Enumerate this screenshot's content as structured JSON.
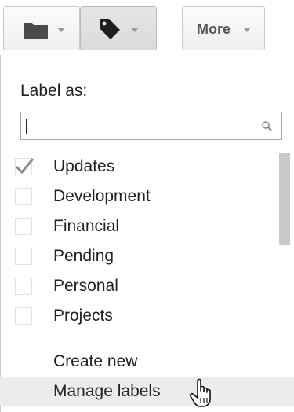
{
  "toolbar": {
    "folder_icon": "folder-icon",
    "label_icon": "tag-icon",
    "more_label": "More",
    "caret_icon": "chevron-down-icon"
  },
  "menu": {
    "heading": "Label as:",
    "search": {
      "value": "",
      "placeholder": "",
      "icon": "search-icon"
    },
    "labels": [
      {
        "label": "Updates",
        "checked": true
      },
      {
        "label": "Development",
        "checked": false
      },
      {
        "label": "Financial",
        "checked": false
      },
      {
        "label": "Pending",
        "checked": false
      },
      {
        "label": "Personal",
        "checked": false
      },
      {
        "label": "Projects",
        "checked": false
      }
    ],
    "actions": [
      {
        "label": "Create new",
        "hovered": false
      },
      {
        "label": "Manage labels",
        "hovered": true
      }
    ]
  },
  "colors": {
    "hover_background": "#ececec",
    "checkmark": "#8c8c8c",
    "scrollbar_thumb": "#c8c8c8"
  }
}
